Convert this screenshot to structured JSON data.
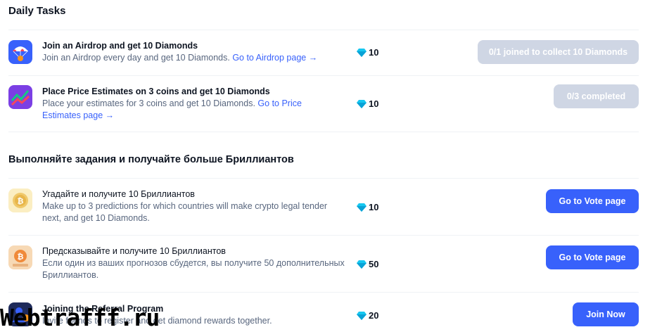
{
  "sections": [
    {
      "title": "Daily Tasks",
      "tasks": [
        {
          "icon": "parachute-airdrop-icon",
          "title": "Join an Airdrop and get 10 Diamonds",
          "desc": "Join an Airdrop every day and get 10 Diamonds.",
          "link": "Go to Airdrop page →",
          "reward": "10",
          "button": "0/1 joined to collect 10 Diamonds"
        },
        {
          "icon": "price-chart-icon",
          "title": "Place Price Estimates on 3 coins and get 10 Diamonds",
          "desc": "Place your estimates for 3 coins and get 10 Diamonds.",
          "link_part1": "Go to Price",
          "link_part2": "Estimates page →",
          "reward": "10",
          "button": "0/3 completed"
        }
      ]
    },
    {
      "title": "Выполняйте задания и получайте больше Бриллиантов",
      "tasks": [
        {
          "icon": "bitcoin-coin-icon",
          "title": "Угадайте и получите 10 Бриллиантов",
          "desc_line1": "Make up to 3 predictions for which countries will make crypto legal tender",
          "desc_line2": "next, and get 10 Diamonds.",
          "reward": "10",
          "button": "Go to Vote page"
        },
        {
          "icon": "bitcoin-ticket-icon",
          "title": "Предсказывайте и получите 10 Бриллиантов",
          "desc_line1": "Если один из ваших прогнозов сбудется, вы получите 50 дополнительных",
          "desc_line2": "Бриллиантов.",
          "reward": "50",
          "button": "Go to Vote page"
        },
        {
          "icon": "referral-user-icon",
          "title": "Joining the Referral Program",
          "desc": "Invite friends to register and get diamond rewards together.",
          "reward": "20",
          "button": "Join Now"
        }
      ]
    }
  ],
  "watermark": "Webtrafff.ru",
  "colors": {
    "accent": "#3861fb",
    "disabled": "#cfd6e4",
    "diamond": "#16c7f0"
  }
}
